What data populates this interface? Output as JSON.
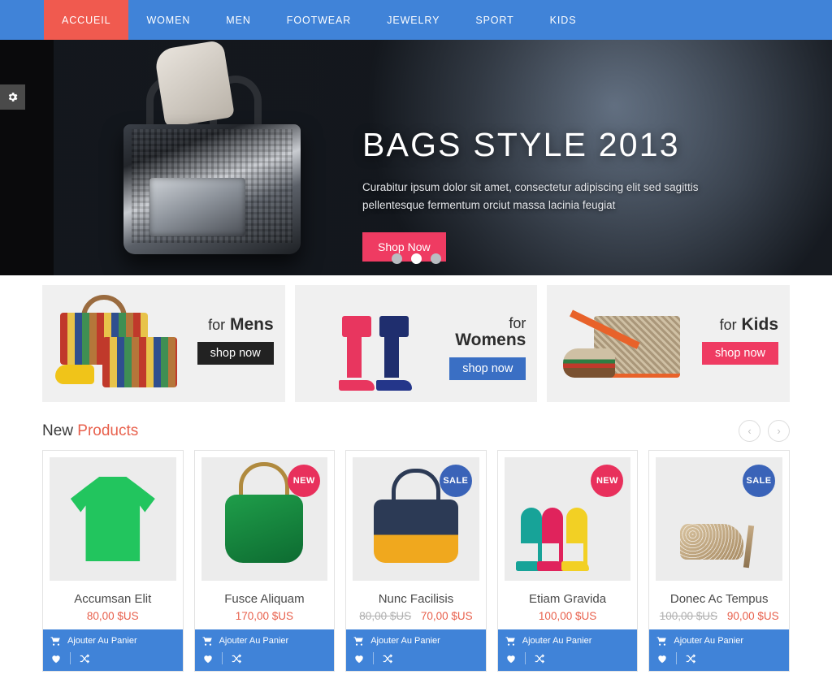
{
  "nav": {
    "items": [
      {
        "label": "ACCUEIL",
        "active": true
      },
      {
        "label": "WOMEN",
        "active": false
      },
      {
        "label": "MEN",
        "active": false
      },
      {
        "label": "FOOTWEAR",
        "active": false
      },
      {
        "label": "JEWELRY",
        "active": false
      },
      {
        "label": "SPORT",
        "active": false
      },
      {
        "label": "KIDS",
        "active": false
      }
    ],
    "active_color": "#f05a4f",
    "bar_color": "#4083d8"
  },
  "settings": {
    "icon": "gear-icon"
  },
  "hero": {
    "title": "BAGS STYLE 2013",
    "subtitle": "Curabitur ipsum dolor sit amet, consectetur adipiscing elit sed sagittis pellentesque fermentum orciut massa lacinia feugiat",
    "button_label": "Shop Now",
    "button_color": "#ef3b62",
    "dots": [
      {
        "active": false
      },
      {
        "active": true
      },
      {
        "active": false
      }
    ]
  },
  "promos": [
    {
      "prefix": "for",
      "name": "Mens",
      "stacked": false,
      "button_label": "shop now",
      "button_style": "dark",
      "art": "mens-striped-bags"
    },
    {
      "prefix": "for",
      "name": "Womens",
      "stacked": true,
      "button_label": "shop now",
      "button_style": "blue",
      "art": "womens-heels"
    },
    {
      "prefix": "for",
      "name": "Kids",
      "stacked": false,
      "button_label": "shop now",
      "button_style": "pink",
      "art": "kids-bag-shoe"
    }
  ],
  "new_products": {
    "title_part1": "New ",
    "title_part2": "Products",
    "accent_color": "#e8604c",
    "prev_label": "‹",
    "next_label": "›",
    "add_to_cart_label": "Ajouter Au Panier",
    "items": [
      {
        "name": "Accumsan Elit",
        "price": "80,00 $US",
        "old_price": "",
        "badge": "",
        "badge_type": "",
        "art": "green-tshirt",
        "add_to_cart_label": "Ajouter Au Panier"
      },
      {
        "name": "Fusce Aliquam",
        "price": "170,00 $US",
        "old_price": "",
        "badge": "NEW",
        "badge_type": "new",
        "art": "green-handbag",
        "add_to_cart_label": "Ajouter Au Panier"
      },
      {
        "name": "Nunc Facilisis",
        "price": "70,00 $US",
        "old_price": "80,00 $US",
        "badge": "SALE",
        "badge_type": "sale",
        "art": "navy-yellow-bag",
        "add_to_cart_label": "Ajouter Au Panier"
      },
      {
        "name": "Etiam Gravida",
        "price": "100,00 $US",
        "old_price": "",
        "badge": "NEW",
        "badge_type": "new",
        "art": "colored-pumps",
        "add_to_cart_label": "Ajouter Au Panier"
      },
      {
        "name": "Donec Ac Tempus",
        "price": "90,00 $US",
        "old_price": "100,00 $US",
        "badge": "SALE",
        "badge_type": "sale",
        "art": "glitter-pump",
        "add_to_cart_label": "Ajouter Au Panier"
      }
    ]
  }
}
